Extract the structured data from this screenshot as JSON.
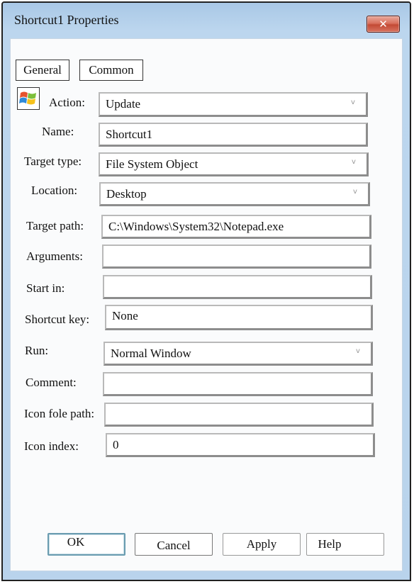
{
  "window": {
    "title": "Shortcut1 Properties",
    "close_glyph": "✕"
  },
  "tabs": [
    {
      "label": "General",
      "active": true
    },
    {
      "label": "Common",
      "active": false
    }
  ],
  "app_icon": "windows-logo-icon",
  "form": {
    "action": {
      "label": "Action:",
      "value": "Update",
      "type": "select"
    },
    "name": {
      "label": "Name:",
      "value": "Shortcut1",
      "type": "text"
    },
    "target_type": {
      "label": "Target type:",
      "value": "File System Object",
      "type": "select"
    },
    "location": {
      "label": "Location:",
      "value": "Desktop",
      "type": "select"
    },
    "target_path": {
      "label": "Target path:",
      "value": "C:\\Windows\\System32\\Notepad.exe",
      "type": "text"
    },
    "arguments": {
      "label": "Arguments:",
      "value": "",
      "type": "text"
    },
    "start_in": {
      "label": "Start in:",
      "value": "",
      "type": "text"
    },
    "shortcut_key": {
      "label": "Shortcut key:",
      "value": "None",
      "type": "text"
    },
    "run": {
      "label": "Run:",
      "value": "Normal Window",
      "type": "select"
    },
    "comment": {
      "label": "Comment:",
      "value": "",
      "type": "text"
    },
    "icon_file_path": {
      "label": "Icon fole path:",
      "value": "",
      "type": "text"
    },
    "icon_index": {
      "label": "Icon index:",
      "value": "0",
      "type": "text"
    }
  },
  "chevron_glyph": "v",
  "buttons": {
    "ok": "OK",
    "cancel": "Cancel",
    "apply": "Apply",
    "help": "Help"
  }
}
